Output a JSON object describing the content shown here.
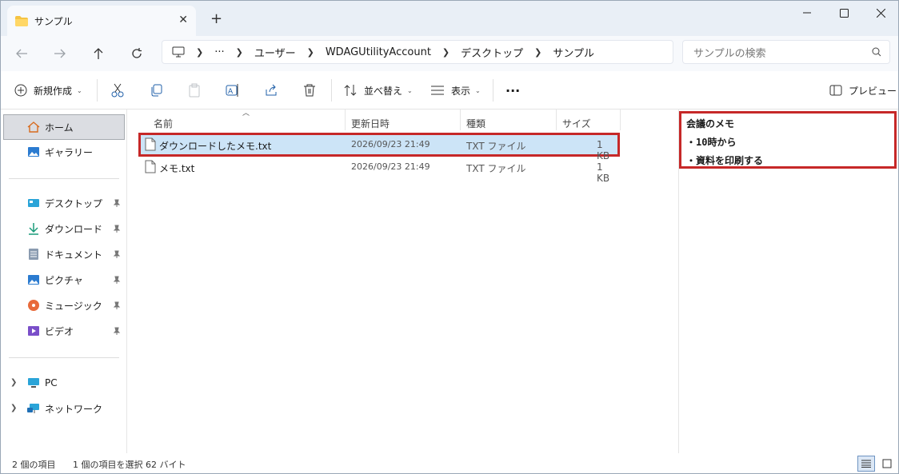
{
  "tab": {
    "title": "サンプル",
    "close": "✕",
    "new_tab": "+"
  },
  "window_controls": {
    "minimize": "—",
    "maximize": "☐",
    "close": "✕"
  },
  "breadcrumb": {
    "more": "···",
    "items": [
      "ユーザー",
      "WDAGUtilityAccount",
      "デスクトップ",
      "サンプル"
    ]
  },
  "search": {
    "placeholder": "サンプルの検索"
  },
  "toolbar": {
    "new_label": "新規作成",
    "sort_label": "並べ替え",
    "view_label": "表示",
    "more": "···",
    "preview_label": "プレビュー"
  },
  "sidebar": {
    "home": "ホーム",
    "gallery": "ギャラリー",
    "quick_access": [
      "デスクトップ",
      "ダウンロード",
      "ドキュメント",
      "ピクチャ",
      "ミュージック",
      "ビデオ"
    ],
    "pc": "PC",
    "network": "ネットワーク"
  },
  "columns": {
    "name": "名前",
    "date": "更新日時",
    "type": "種類",
    "size": "サイズ"
  },
  "files": [
    {
      "name": "ダウンロードしたメモ.txt",
      "date": "2026/09/23 21:49",
      "type": "TXT ファイル",
      "size": "1 KB",
      "selected": true
    },
    {
      "name": "メモ.txt",
      "date": "2026/09/23 21:49",
      "type": "TXT ファイル",
      "size": "1 KB",
      "selected": false
    }
  ],
  "preview": {
    "lines": [
      "会議のメモ",
      "・10時から",
      "・資料を印刷する"
    ]
  },
  "status": {
    "count": "2 個の項目",
    "selection": "1 個の項目を選択  62 バイト"
  },
  "colors": {
    "highlight": "#c62828",
    "selection": "#cce4f7",
    "accent": "#0067c0"
  }
}
